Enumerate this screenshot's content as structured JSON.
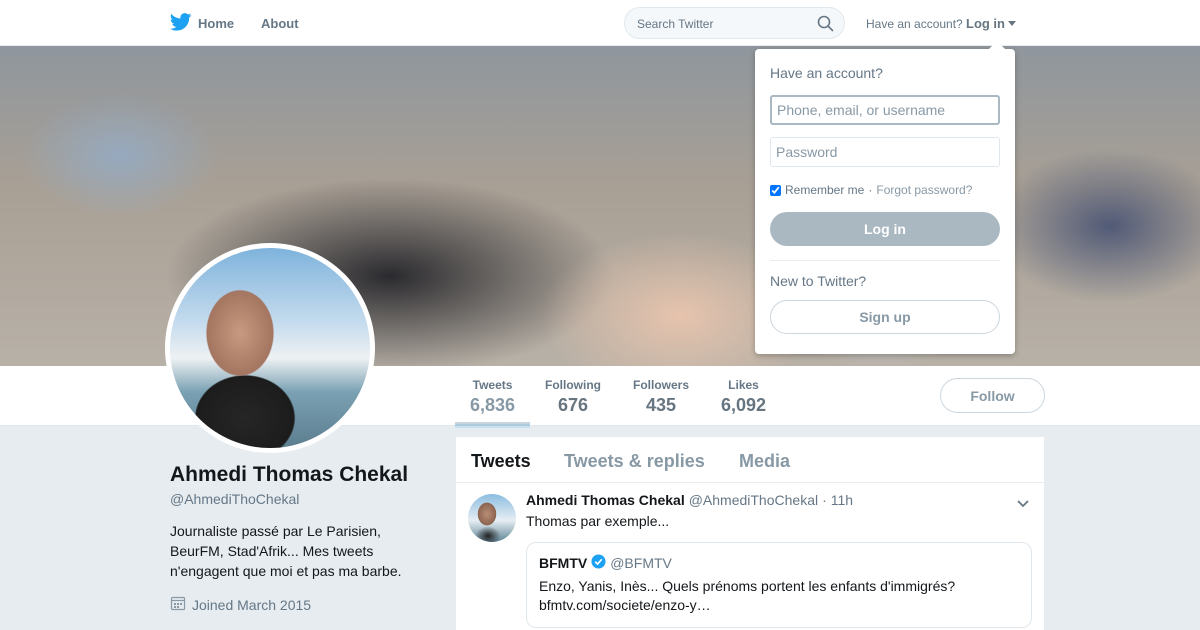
{
  "nav": {
    "home_label": "Home",
    "about_label": "About",
    "search_placeholder": "Search Twitter",
    "have_account_text": "Have an account?",
    "login_label": "Log in",
    "brand_color": "#1da1f2"
  },
  "profile": {
    "name": "Ahmedi Thomas Chekal",
    "handle": "@AhmediThoChekal",
    "bio": "Journaliste passé par Le Parisien, BeurFM, Stad'Afrik... Mes tweets n'engagent que moi et pas ma barbe.",
    "joined": "Joined March 2015"
  },
  "stats": [
    {
      "label": "Tweets",
      "value": "6,836"
    },
    {
      "label": "Following",
      "value": "676"
    },
    {
      "label": "Followers",
      "value": "435"
    },
    {
      "label": "Likes",
      "value": "6,092"
    }
  ],
  "follow_label": "Follow",
  "timeline": {
    "tabs": [
      "Tweets",
      "Tweets & replies",
      "Media"
    ],
    "tweet": {
      "name": "Ahmedi Thomas Chekal",
      "handle": "@AhmediThoChekal",
      "separator": "·",
      "time": "11h",
      "text": "Thomas par exemple...",
      "quote": {
        "name": "BFMTV",
        "handle": "@BFMTV",
        "text": "Enzo, Yanis, Inès... Quels prénoms portent les enfants d'immigrés? bfmtv.com/societe/enzo-y…"
      }
    }
  },
  "login_dropdown": {
    "title": "Have an account?",
    "username_placeholder": "Phone, email, or username",
    "password_placeholder": "Password",
    "remember_label": "Remember me",
    "separator": "·",
    "forgot_label": "Forgot password?",
    "login_button": "Log in",
    "new_text": "New to Twitter?",
    "signup_button": "Sign up"
  }
}
